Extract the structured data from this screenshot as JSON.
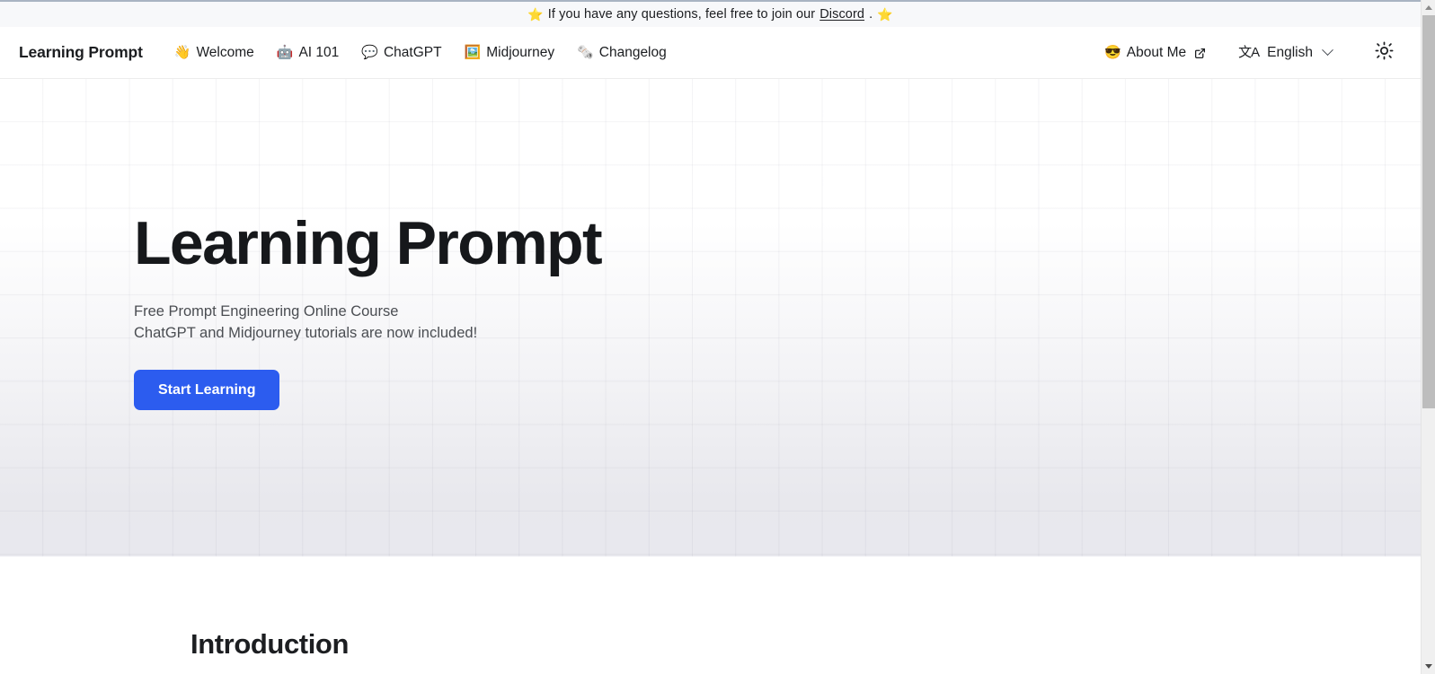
{
  "announcement": {
    "star_icon": "⭐",
    "text_before": "If you have any questions, feel free to join our",
    "link_label": "Discord",
    "text_after": ".",
    "trailing_star_icon": "⭐"
  },
  "navbar": {
    "brand": "Learning Prompt",
    "items": [
      {
        "emoji": "👋",
        "label": "Welcome",
        "icon_name": "waving-hand-icon"
      },
      {
        "emoji": "🤖",
        "label": "AI 101",
        "icon_name": "robot-icon"
      },
      {
        "emoji": "💬",
        "label": "ChatGPT",
        "icon_name": "speech-balloon-icon"
      },
      {
        "emoji": "🖼️",
        "label": "Midjourney",
        "icon_name": "framed-picture-icon"
      },
      {
        "emoji": "🗞️",
        "label": "Changelog",
        "icon_name": "newspaper-icon"
      }
    ],
    "about": {
      "emoji": "😎",
      "label": "About Me",
      "icon_name": "sunglasses-face-icon"
    },
    "language": {
      "icon_glyph": "文A",
      "label": "English"
    },
    "theme_toggle": {
      "icon_name": "sun-icon",
      "mode": "light"
    }
  },
  "hero": {
    "title": "Learning Prompt",
    "subtitle_line1": "Free Prompt Engineering Online Course",
    "subtitle_line2": "ChatGPT and Midjourney tutorials are now included!",
    "cta_label": "Start Learning"
  },
  "main": {
    "section_title": "Introduction"
  },
  "colors": {
    "accent_blue": "#2c5cef",
    "text_primary": "#1c1e21",
    "text_secondary": "#4a4d52",
    "announcement_bg": "#f7f8fa",
    "announcement_border": "#a9b4c2",
    "hero_bottom": "#e8e8ed"
  }
}
